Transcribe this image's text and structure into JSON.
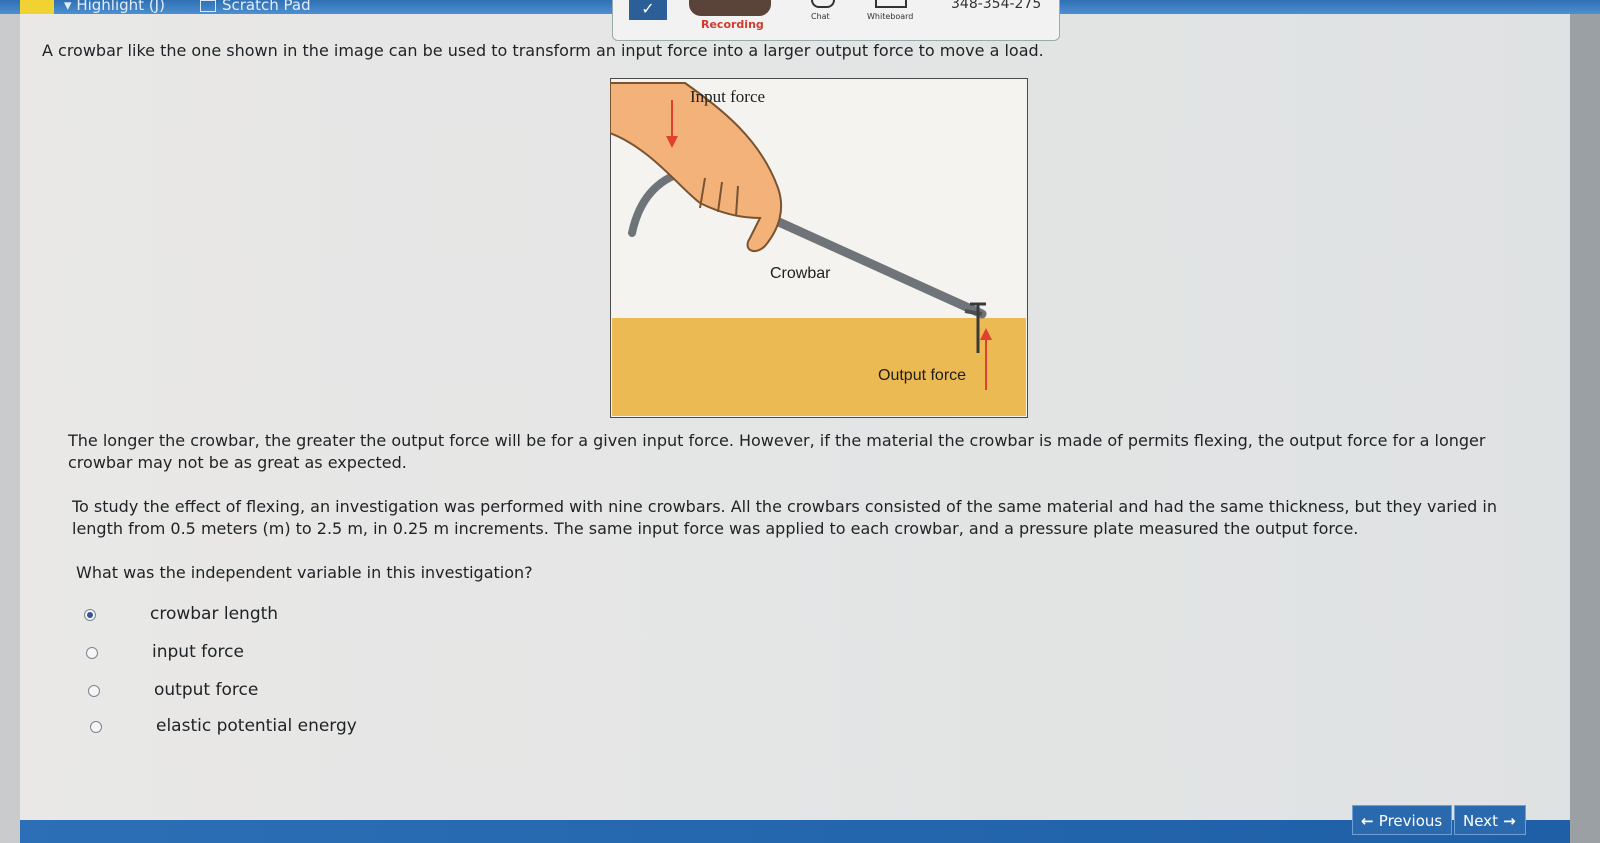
{
  "toolbar": {
    "highlight_label": "Highlight (J)",
    "scratchpad_label": "Scratch Pad",
    "recording_label": "Recording",
    "chat_label": "Chat",
    "whiteboard_label": "Whiteboard",
    "session_code": "348-354-275"
  },
  "question": {
    "intro": "A crowbar like the one shown in the image can be used to transform an input force into a larger output force to move a load.",
    "paragraph1": "The longer the crowbar, the greater the output force will be for a given input force. However, if the material the crowbar is made of permits flexing, the output force for a longer crowbar may not be as great as expected.",
    "paragraph2": "To study the effect of flexing, an investigation was performed with nine crowbars. All the crowbars consisted of the same material and had the same thickness, but they varied in length from 0.5 meters (m) to 2.5 m, in 0.25 m increments. The same input force was applied to each crowbar, and a pressure plate measured the output force.",
    "prompt": "What was the independent variable in this investigation?"
  },
  "diagram": {
    "input_label": "Input force",
    "crowbar_label": "Crowbar",
    "output_label": "Output force",
    "ground_color": "#ecba52",
    "arrow_color": "#e0412f"
  },
  "options": [
    {
      "label": "crowbar length",
      "selected": true
    },
    {
      "label": "input force",
      "selected": false
    },
    {
      "label": "output force",
      "selected": false
    },
    {
      "label": "elastic potential energy",
      "selected": false
    }
  ],
  "nav": {
    "previous_label": "Previous",
    "next_label": "Next"
  }
}
